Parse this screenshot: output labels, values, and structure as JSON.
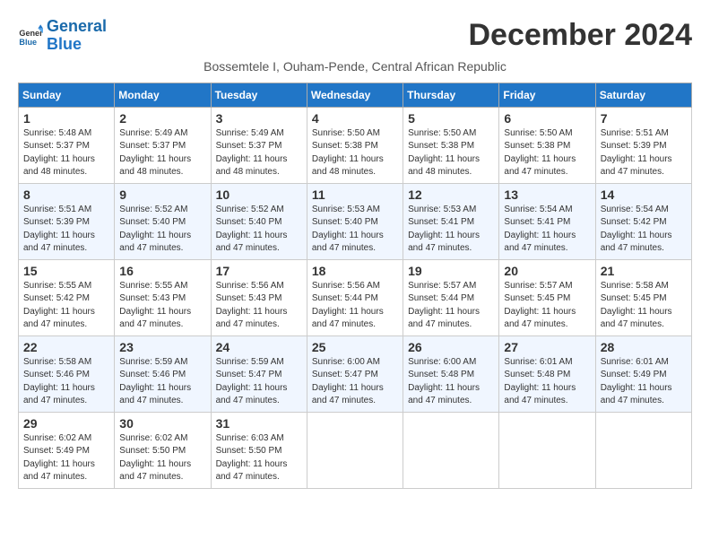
{
  "logo": {
    "line1": "General",
    "line2": "Blue"
  },
  "title": "December 2024",
  "subtitle": "Bossemtele I, Ouham-Pende, Central African Republic",
  "days_of_week": [
    "Sunday",
    "Monday",
    "Tuesday",
    "Wednesday",
    "Thursday",
    "Friday",
    "Saturday"
  ],
  "weeks": [
    [
      {
        "day": "1",
        "detail": "Sunrise: 5:48 AM\nSunset: 5:37 PM\nDaylight: 11 hours\nand 48 minutes."
      },
      {
        "day": "2",
        "detail": "Sunrise: 5:49 AM\nSunset: 5:37 PM\nDaylight: 11 hours\nand 48 minutes."
      },
      {
        "day": "3",
        "detail": "Sunrise: 5:49 AM\nSunset: 5:37 PM\nDaylight: 11 hours\nand 48 minutes."
      },
      {
        "day": "4",
        "detail": "Sunrise: 5:50 AM\nSunset: 5:38 PM\nDaylight: 11 hours\nand 48 minutes."
      },
      {
        "day": "5",
        "detail": "Sunrise: 5:50 AM\nSunset: 5:38 PM\nDaylight: 11 hours\nand 48 minutes."
      },
      {
        "day": "6",
        "detail": "Sunrise: 5:50 AM\nSunset: 5:38 PM\nDaylight: 11 hours\nand 47 minutes."
      },
      {
        "day": "7",
        "detail": "Sunrise: 5:51 AM\nSunset: 5:39 PM\nDaylight: 11 hours\nand 47 minutes."
      }
    ],
    [
      {
        "day": "8",
        "detail": "Sunrise: 5:51 AM\nSunset: 5:39 PM\nDaylight: 11 hours\nand 47 minutes."
      },
      {
        "day": "9",
        "detail": "Sunrise: 5:52 AM\nSunset: 5:40 PM\nDaylight: 11 hours\nand 47 minutes."
      },
      {
        "day": "10",
        "detail": "Sunrise: 5:52 AM\nSunset: 5:40 PM\nDaylight: 11 hours\nand 47 minutes."
      },
      {
        "day": "11",
        "detail": "Sunrise: 5:53 AM\nSunset: 5:40 PM\nDaylight: 11 hours\nand 47 minutes."
      },
      {
        "day": "12",
        "detail": "Sunrise: 5:53 AM\nSunset: 5:41 PM\nDaylight: 11 hours\nand 47 minutes."
      },
      {
        "day": "13",
        "detail": "Sunrise: 5:54 AM\nSunset: 5:41 PM\nDaylight: 11 hours\nand 47 minutes."
      },
      {
        "day": "14",
        "detail": "Sunrise: 5:54 AM\nSunset: 5:42 PM\nDaylight: 11 hours\nand 47 minutes."
      }
    ],
    [
      {
        "day": "15",
        "detail": "Sunrise: 5:55 AM\nSunset: 5:42 PM\nDaylight: 11 hours\nand 47 minutes."
      },
      {
        "day": "16",
        "detail": "Sunrise: 5:55 AM\nSunset: 5:43 PM\nDaylight: 11 hours\nand 47 minutes."
      },
      {
        "day": "17",
        "detail": "Sunrise: 5:56 AM\nSunset: 5:43 PM\nDaylight: 11 hours\nand 47 minutes."
      },
      {
        "day": "18",
        "detail": "Sunrise: 5:56 AM\nSunset: 5:44 PM\nDaylight: 11 hours\nand 47 minutes."
      },
      {
        "day": "19",
        "detail": "Sunrise: 5:57 AM\nSunset: 5:44 PM\nDaylight: 11 hours\nand 47 minutes."
      },
      {
        "day": "20",
        "detail": "Sunrise: 5:57 AM\nSunset: 5:45 PM\nDaylight: 11 hours\nand 47 minutes."
      },
      {
        "day": "21",
        "detail": "Sunrise: 5:58 AM\nSunset: 5:45 PM\nDaylight: 11 hours\nand 47 minutes."
      }
    ],
    [
      {
        "day": "22",
        "detail": "Sunrise: 5:58 AM\nSunset: 5:46 PM\nDaylight: 11 hours\nand 47 minutes."
      },
      {
        "day": "23",
        "detail": "Sunrise: 5:59 AM\nSunset: 5:46 PM\nDaylight: 11 hours\nand 47 minutes."
      },
      {
        "day": "24",
        "detail": "Sunrise: 5:59 AM\nSunset: 5:47 PM\nDaylight: 11 hours\nand 47 minutes."
      },
      {
        "day": "25",
        "detail": "Sunrise: 6:00 AM\nSunset: 5:47 PM\nDaylight: 11 hours\nand 47 minutes."
      },
      {
        "day": "26",
        "detail": "Sunrise: 6:00 AM\nSunset: 5:48 PM\nDaylight: 11 hours\nand 47 minutes."
      },
      {
        "day": "27",
        "detail": "Sunrise: 6:01 AM\nSunset: 5:48 PM\nDaylight: 11 hours\nand 47 minutes."
      },
      {
        "day": "28",
        "detail": "Sunrise: 6:01 AM\nSunset: 5:49 PM\nDaylight: 11 hours\nand 47 minutes."
      }
    ],
    [
      {
        "day": "29",
        "detail": "Sunrise: 6:02 AM\nSunset: 5:49 PM\nDaylight: 11 hours\nand 47 minutes."
      },
      {
        "day": "30",
        "detail": "Sunrise: 6:02 AM\nSunset: 5:50 PM\nDaylight: 11 hours\nand 47 minutes."
      },
      {
        "day": "31",
        "detail": "Sunrise: 6:03 AM\nSunset: 5:50 PM\nDaylight: 11 hours\nand 47 minutes."
      },
      {
        "day": "",
        "detail": ""
      },
      {
        "day": "",
        "detail": ""
      },
      {
        "day": "",
        "detail": ""
      },
      {
        "day": "",
        "detail": ""
      }
    ]
  ]
}
